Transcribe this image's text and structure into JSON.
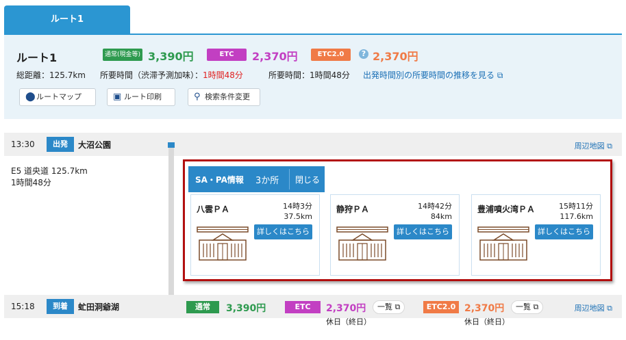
{
  "tab": {
    "label": "ルート1"
  },
  "summary": {
    "title": "ルート1",
    "normal_badge": "通常(現金等)",
    "normal_price": "3,390円",
    "etc_badge": "ETC",
    "etc_price": "2,370円",
    "etc2_badge": "ETC2.0",
    "etc2_price": "2,370円",
    "help_icon": "?",
    "distance": "総距離：125.7km",
    "time_pred_label": "所要時間（渋滞予測加味）：",
    "time_pred_value": "1時間48分",
    "time_label": "所要時間：1時間48分",
    "trend_link": "出発時間別の所要時間の推移を見る"
  },
  "buttons": {
    "map": "ルートマップ",
    "print": "ルート印刷",
    "change": "検索条件変更"
  },
  "departure": {
    "time": "13:30",
    "tag": "出発",
    "place": "大沼公園",
    "map_link": "周辺地図"
  },
  "road": {
    "line1": "E5 道央道 125.7km",
    "line2": "1時間48分"
  },
  "sapa": {
    "title": "SA・PA情報",
    "count": "3か所",
    "close": "閉じる",
    "cards": [
      {
        "name": "八雲ＰＡ",
        "time": "14時3分",
        "dist": "37.5km",
        "detail": "詳しくはこちら"
      },
      {
        "name": "静狩ＰＡ",
        "time": "14時42分",
        "dist": "84km",
        "detail": "詳しくはこちら"
      },
      {
        "name": "豊浦噴火湾ＰＡ",
        "time": "15時11分",
        "dist": "117.6km",
        "detail": "詳しくはこちら"
      }
    ]
  },
  "arrival": {
    "time": "15:18",
    "tag": "到着",
    "place": "虻田洞爺湖",
    "map_link": "周辺地図",
    "normal_label": "通常",
    "normal_price": "3,390円",
    "etc_label": "ETC",
    "etc_price": "2,370円",
    "etc_note": "休日（終日）",
    "etc_list": "一覧",
    "etc2_label": "ETC2.0",
    "etc2_price": "2,370円",
    "etc2_note": "休日（終日）",
    "etc2_list": "一覧"
  },
  "colors": {
    "accent": "#2b96d2",
    "normal_green": "#2e9a4f",
    "etc_purple": "#c23fc2",
    "etc2_orange": "#f07a46",
    "highlight_red": "#b20e0e"
  }
}
